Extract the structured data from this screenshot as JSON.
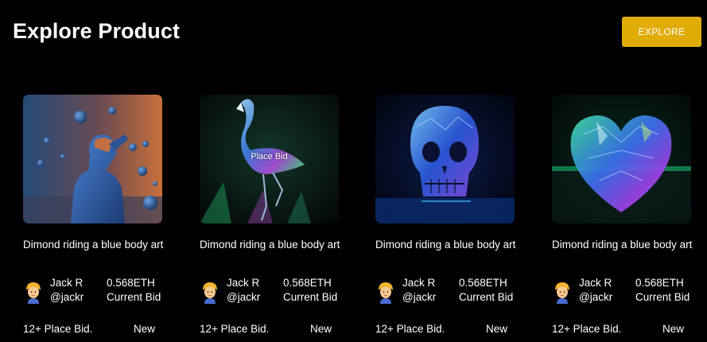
{
  "header": {
    "title": "Explore Product",
    "explore_label": "EXPLORE"
  },
  "colors": {
    "background": "#000000",
    "accent": "#e0ac08",
    "text": "#ffffff"
  },
  "cards": [
    {
      "title": "Dimond riding a blue body art",
      "owner_name": "Jack R",
      "owner_handle": "@jackr",
      "price": "0.568ETH",
      "price_label": "Current Bid",
      "bids": "12+ Place Bid.",
      "status": "New",
      "image": "blue-figure-with-spheres",
      "hover_label": ""
    },
    {
      "title": "Dimond riding a blue body art",
      "owner_name": "Jack R",
      "owner_handle": "@jackr",
      "price": "0.568ETH",
      "price_label": "Current Bid",
      "bids": "12+ Place Bid.",
      "status": "New",
      "image": "crystal-flamingo",
      "hover_label": "Place Bid"
    },
    {
      "title": "Dimond riding a blue body art",
      "owner_name": "Jack R",
      "owner_handle": "@jackr",
      "price": "0.568ETH",
      "price_label": "Current Bid",
      "bids": "12+ Place Bid.",
      "status": "New",
      "image": "crystal-skull",
      "hover_label": ""
    },
    {
      "title": "Dimond riding a blue body art",
      "owner_name": "Jack R",
      "owner_handle": "@jackr",
      "price": "0.568ETH",
      "price_label": "Current Bid",
      "bids": "12+ Place Bid.",
      "status": "New",
      "image": "crystal-heart",
      "hover_label": ""
    }
  ]
}
